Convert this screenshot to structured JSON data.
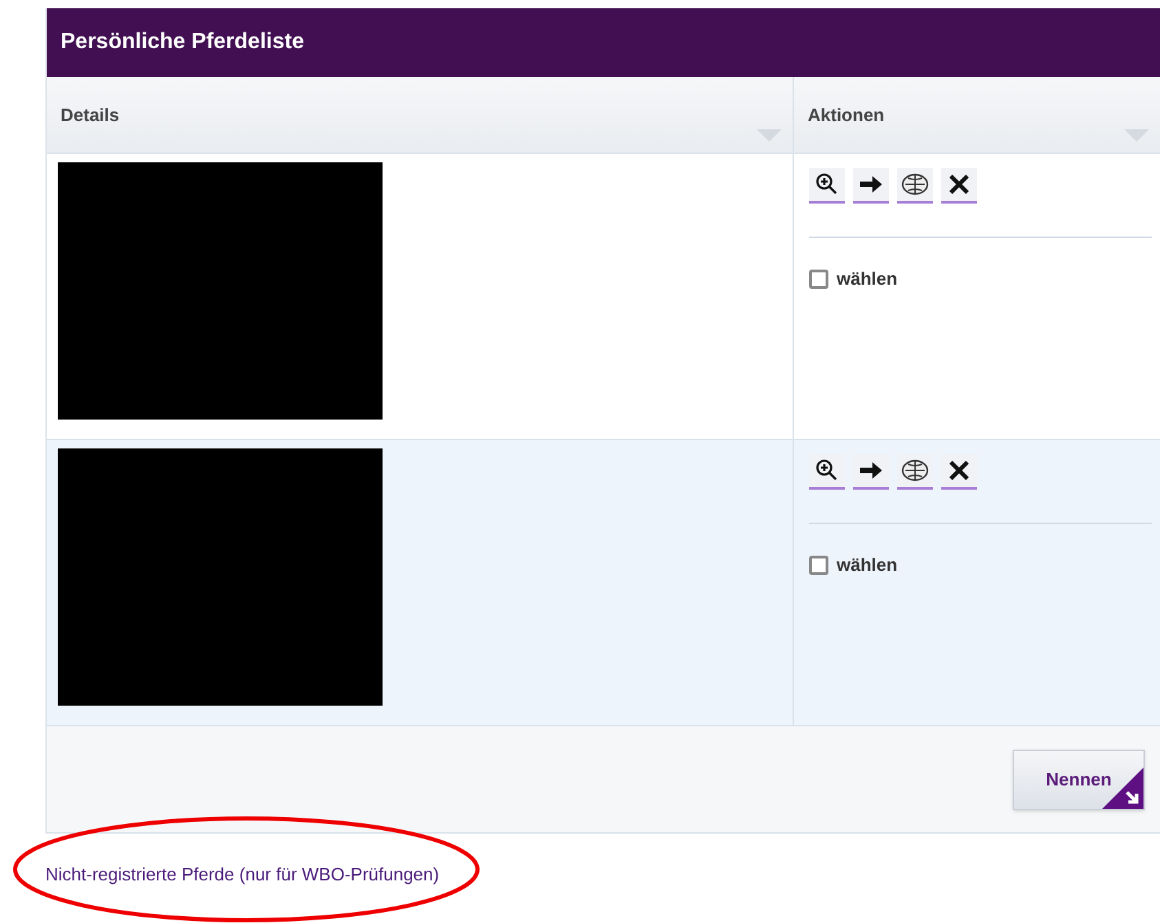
{
  "panel": {
    "title": "Persönliche Pferdeliste"
  },
  "table": {
    "columns": [
      "Details",
      "Aktionen"
    ],
    "rows": [
      {
        "select": {
          "label": "wählen",
          "checked": false
        }
      },
      {
        "select": {
          "label": "wählen",
          "checked": false
        }
      }
    ]
  },
  "footer": {
    "button": "Nennen"
  },
  "link": "Nicht-registrierte Pferde (nur für WBO-Prüfungen)"
}
